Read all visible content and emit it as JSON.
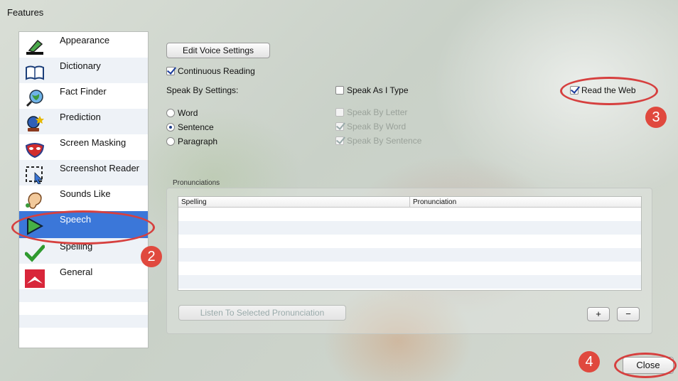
{
  "window": {
    "title": "Features"
  },
  "sidebar": {
    "items": [
      {
        "label": "Appearance",
        "icon": "highlighter-icon"
      },
      {
        "label": "Dictionary",
        "icon": "book-icon"
      },
      {
        "label": "Fact Finder",
        "icon": "magnifier-globe-icon"
      },
      {
        "label": "Prediction",
        "icon": "crystal-ball-icon"
      },
      {
        "label": "Screen Masking",
        "icon": "mask-icon"
      },
      {
        "label": "Screenshot Reader",
        "icon": "screenshot-selection-icon"
      },
      {
        "label": "Sounds Like",
        "icon": "ear-icon"
      },
      {
        "label": "Speech",
        "icon": "play-triangle-icon"
      },
      {
        "label": "Spelling",
        "icon": "checkmark-icon"
      },
      {
        "label": "General",
        "icon": "general-logo-icon"
      }
    ],
    "selected": "Speech"
  },
  "speech": {
    "edit_voice_label": "Edit Voice Settings",
    "continuous_reading_label": "Continuous Reading",
    "continuous_reading_checked": true,
    "speak_by_settings_label": "Speak By Settings:",
    "radio_options": [
      "Word",
      "Sentence",
      "Paragraph"
    ],
    "radio_selected": "Sentence",
    "speak_as_i_type_label": "Speak As I Type",
    "speak_as_i_type_checked": false,
    "speak_by_letter_label": "Speak By Letter",
    "speak_by_word_label": "Speak By Word",
    "speak_by_sentence_label": "Speak By Sentence",
    "read_the_web_label": "Read the Web",
    "read_the_web_checked": true
  },
  "pronunciations": {
    "group_label": "Pronunciations",
    "columns": [
      "Spelling",
      "Pronunciation"
    ],
    "rows": [],
    "listen_button_label": "Listen To Selected Pronunciation",
    "add_label": "+",
    "remove_label": "−"
  },
  "footer": {
    "close_label": "Close"
  },
  "annotations": {
    "step2": "2",
    "step3": "3",
    "step4": "4",
    "ring_color": "#d6403f",
    "marker_color": "#e0493e"
  },
  "colors": {
    "selection_blue": "#3b77d9",
    "row_alt": "#eef2f7"
  }
}
